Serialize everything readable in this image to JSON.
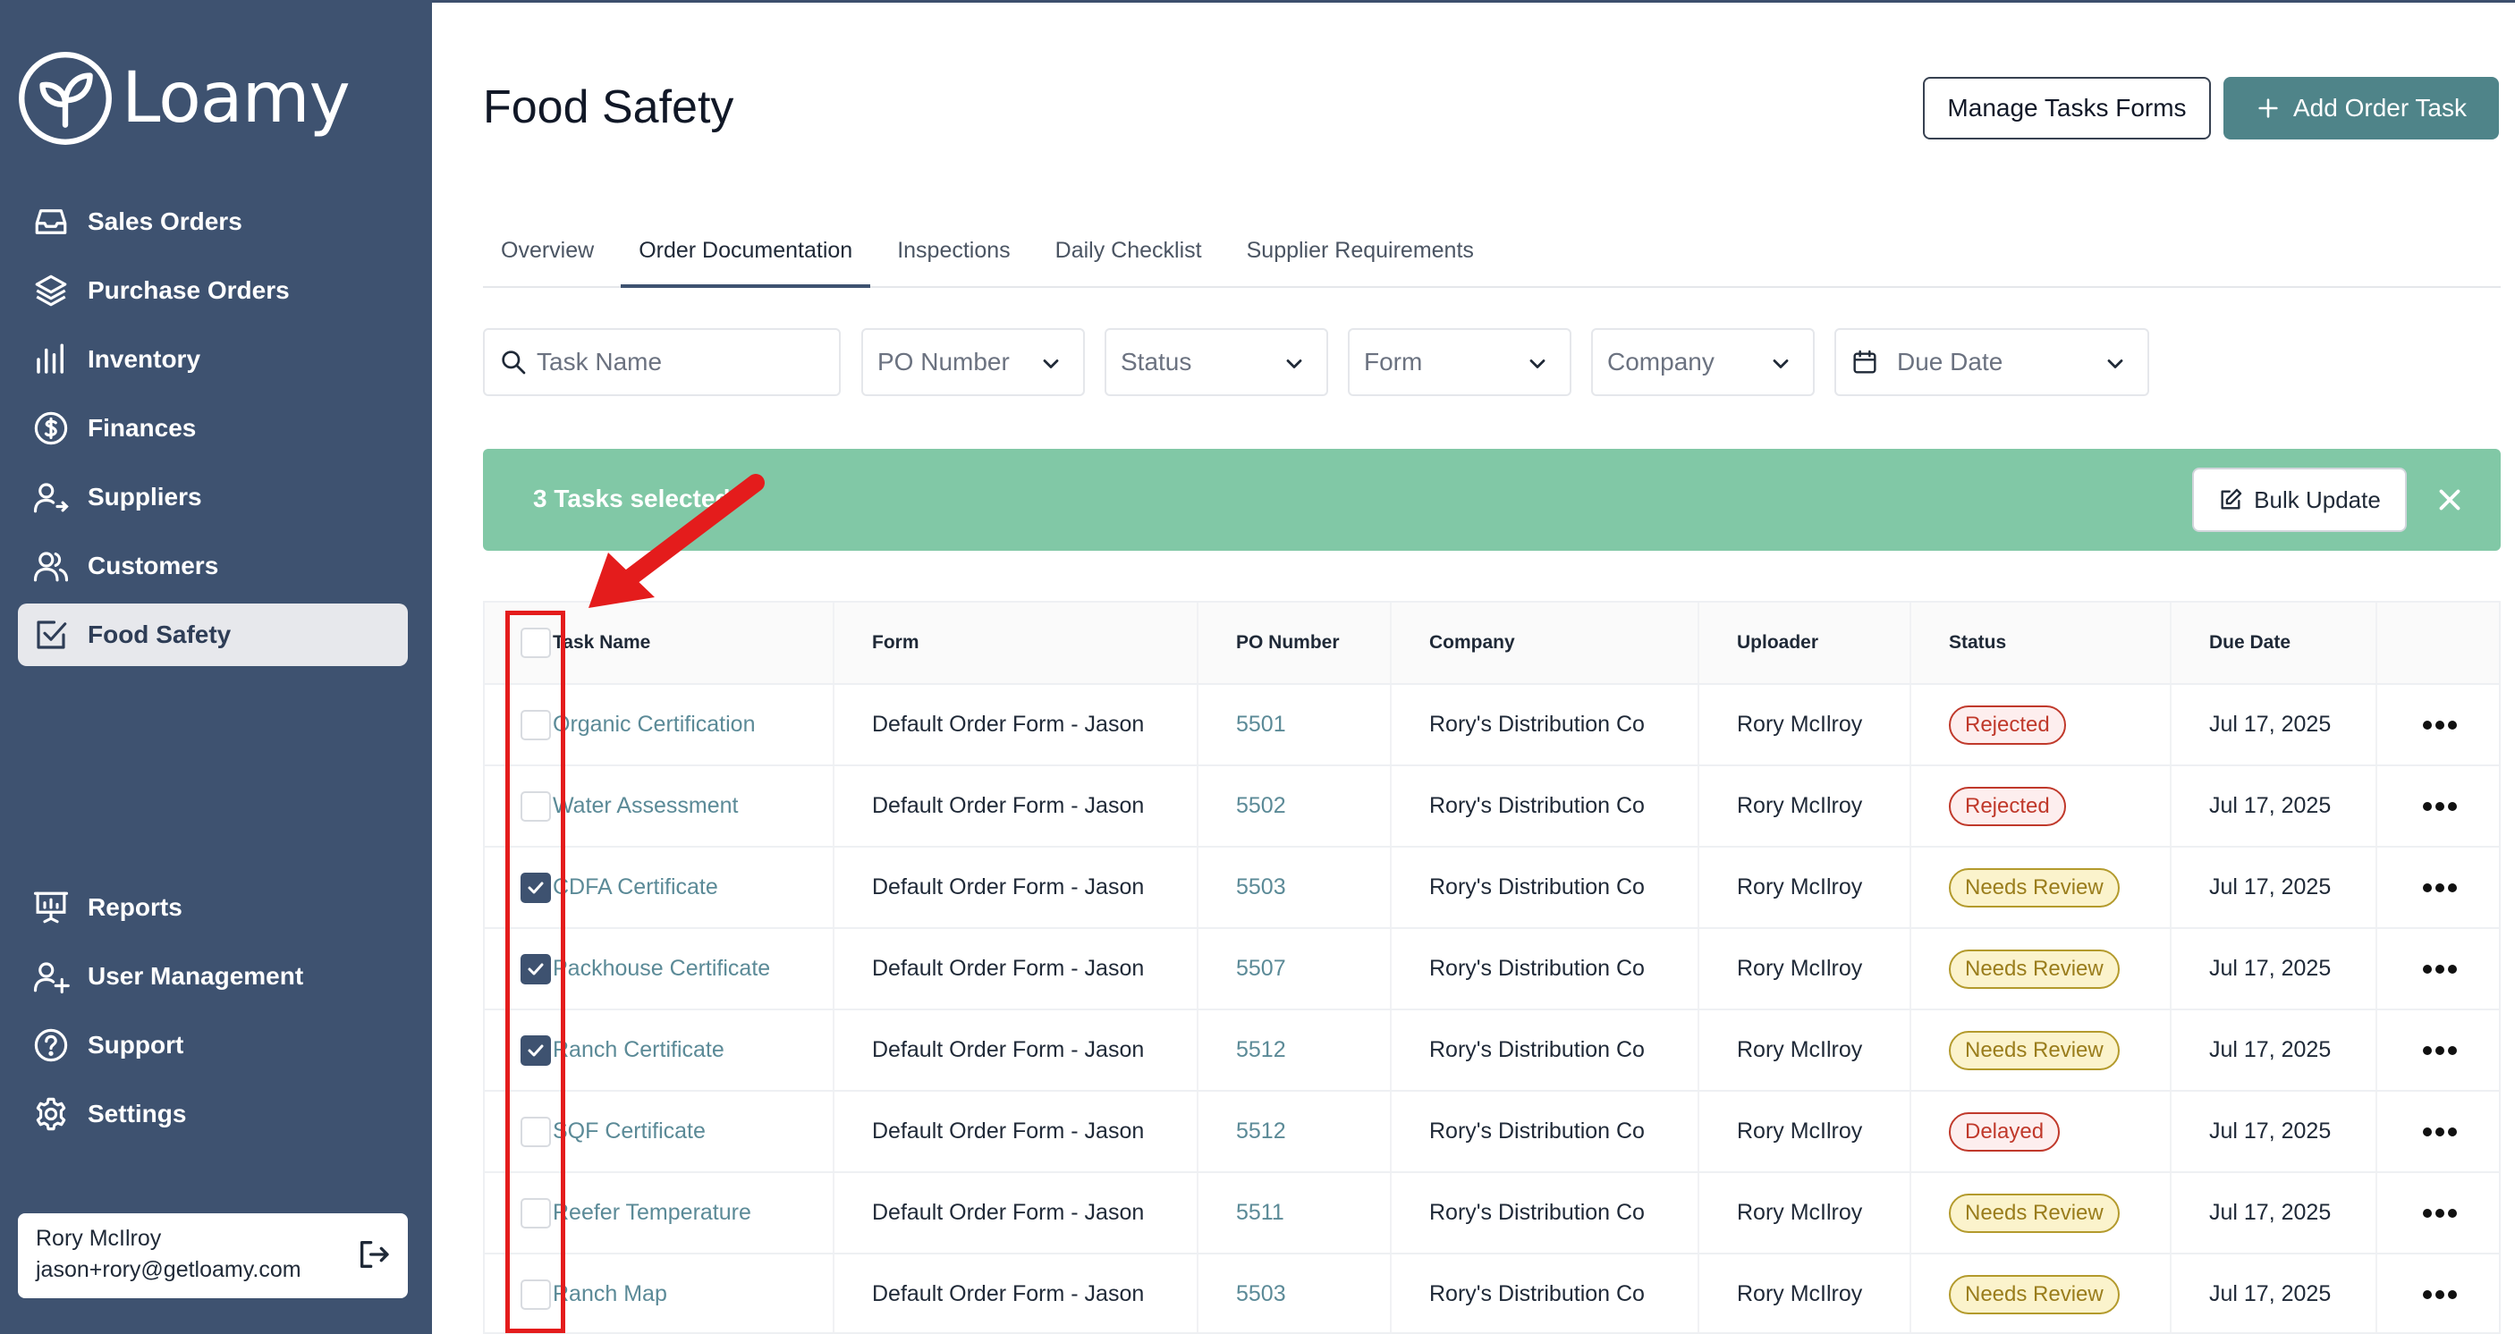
{
  "brand": {
    "name": "Loamy",
    "color": "#3e5270",
    "accent": "#4f8489"
  },
  "sidebar": {
    "items": [
      {
        "label": "Sales Orders",
        "icon": "inbox-icon"
      },
      {
        "label": "Purchase Orders",
        "icon": "layers-icon"
      },
      {
        "label": "Inventory",
        "icon": "bar-chart-icon"
      },
      {
        "label": "Finances",
        "icon": "dollar-circle-icon"
      },
      {
        "label": "Suppliers",
        "icon": "user-arrow-icon"
      },
      {
        "label": "Customers",
        "icon": "users-icon"
      },
      {
        "label": "Food Safety",
        "icon": "checkbox-icon",
        "active": true
      }
    ],
    "bottom_items": [
      {
        "label": "Reports",
        "icon": "presentation-chart-icon"
      },
      {
        "label": "User Management",
        "icon": "user-plus-icon"
      },
      {
        "label": "Support",
        "icon": "help-circle-icon"
      },
      {
        "label": "Settings",
        "icon": "gear-icon"
      }
    ],
    "user": {
      "name": "Rory McIlroy",
      "email": "jason+rory@getloamy.com"
    }
  },
  "header": {
    "title": "Food Safety",
    "manage_label": "Manage Tasks Forms",
    "add_label": "Add Order Task"
  },
  "tabs": [
    {
      "label": "Overview"
    },
    {
      "label": "Order Documentation",
      "active": true
    },
    {
      "label": "Inspections"
    },
    {
      "label": "Daily Checklist"
    },
    {
      "label": "Supplier Requirements"
    }
  ],
  "filters": {
    "search_placeholder": "Task Name",
    "po": "PO Number",
    "status": "Status",
    "form": "Form",
    "company": "Company",
    "due": "Due Date"
  },
  "banner": {
    "text": "3 Tasks selected",
    "bulk_label": "Bulk Update",
    "color": "#81c8a6"
  },
  "table": {
    "columns": [
      "Task Name",
      "Form",
      "PO Number",
      "Company",
      "Uploader",
      "Status",
      "Due Date"
    ],
    "rows": [
      {
        "checked": false,
        "task": "Organic Certification",
        "form": "Default Order Form - Jason",
        "po": "5501",
        "company": "Rory's Distribution Co",
        "uploader": "Rory McIlroy",
        "status": "Rejected",
        "status_kind": "rejected",
        "due": "Jul 17, 2025"
      },
      {
        "checked": false,
        "task": "Water Assessment",
        "form": "Default Order Form - Jason",
        "po": "5502",
        "company": "Rory's Distribution Co",
        "uploader": "Rory McIlroy",
        "status": "Rejected",
        "status_kind": "rejected",
        "due": "Jul 17, 2025"
      },
      {
        "checked": true,
        "task": "CDFA Certificate",
        "form": "Default Order Form - Jason",
        "po": "5503",
        "company": "Rory's Distribution Co",
        "uploader": "Rory McIlroy",
        "status": "Needs Review",
        "status_kind": "review",
        "due": "Jul 17, 2025"
      },
      {
        "checked": true,
        "task": "Packhouse Certificate",
        "form": "Default Order Form - Jason",
        "po": "5507",
        "company": "Rory's Distribution Co",
        "uploader": "Rory McIlroy",
        "status": "Needs Review",
        "status_kind": "review",
        "due": "Jul 17, 2025"
      },
      {
        "checked": true,
        "task": "Ranch Certificate",
        "form": "Default Order Form - Jason",
        "po": "5512",
        "company": "Rory's Distribution Co",
        "uploader": "Rory McIlroy",
        "status": "Needs Review",
        "status_kind": "review",
        "due": "Jul 17, 2025"
      },
      {
        "checked": false,
        "task": "SQF Certificate",
        "form": "Default Order Form - Jason",
        "po": "5512",
        "company": "Rory's Distribution Co",
        "uploader": "Rory McIlroy",
        "status": "Delayed",
        "status_kind": "delayed",
        "due": "Jul 17, 2025"
      },
      {
        "checked": false,
        "task": "Reefer Temperature",
        "form": "Default Order Form - Jason",
        "po": "5511",
        "company": "Rory's Distribution Co",
        "uploader": "Rory McIlroy",
        "status": "Needs Review",
        "status_kind": "review",
        "due": "Jul 17, 2025"
      },
      {
        "checked": false,
        "task": "Ranch Map",
        "form": "Default Order Form - Jason",
        "po": "5503",
        "company": "Rory's Distribution Co",
        "uploader": "Rory McIlroy",
        "status": "Needs Review",
        "status_kind": "review",
        "due": "Jul 17, 2025"
      }
    ]
  }
}
